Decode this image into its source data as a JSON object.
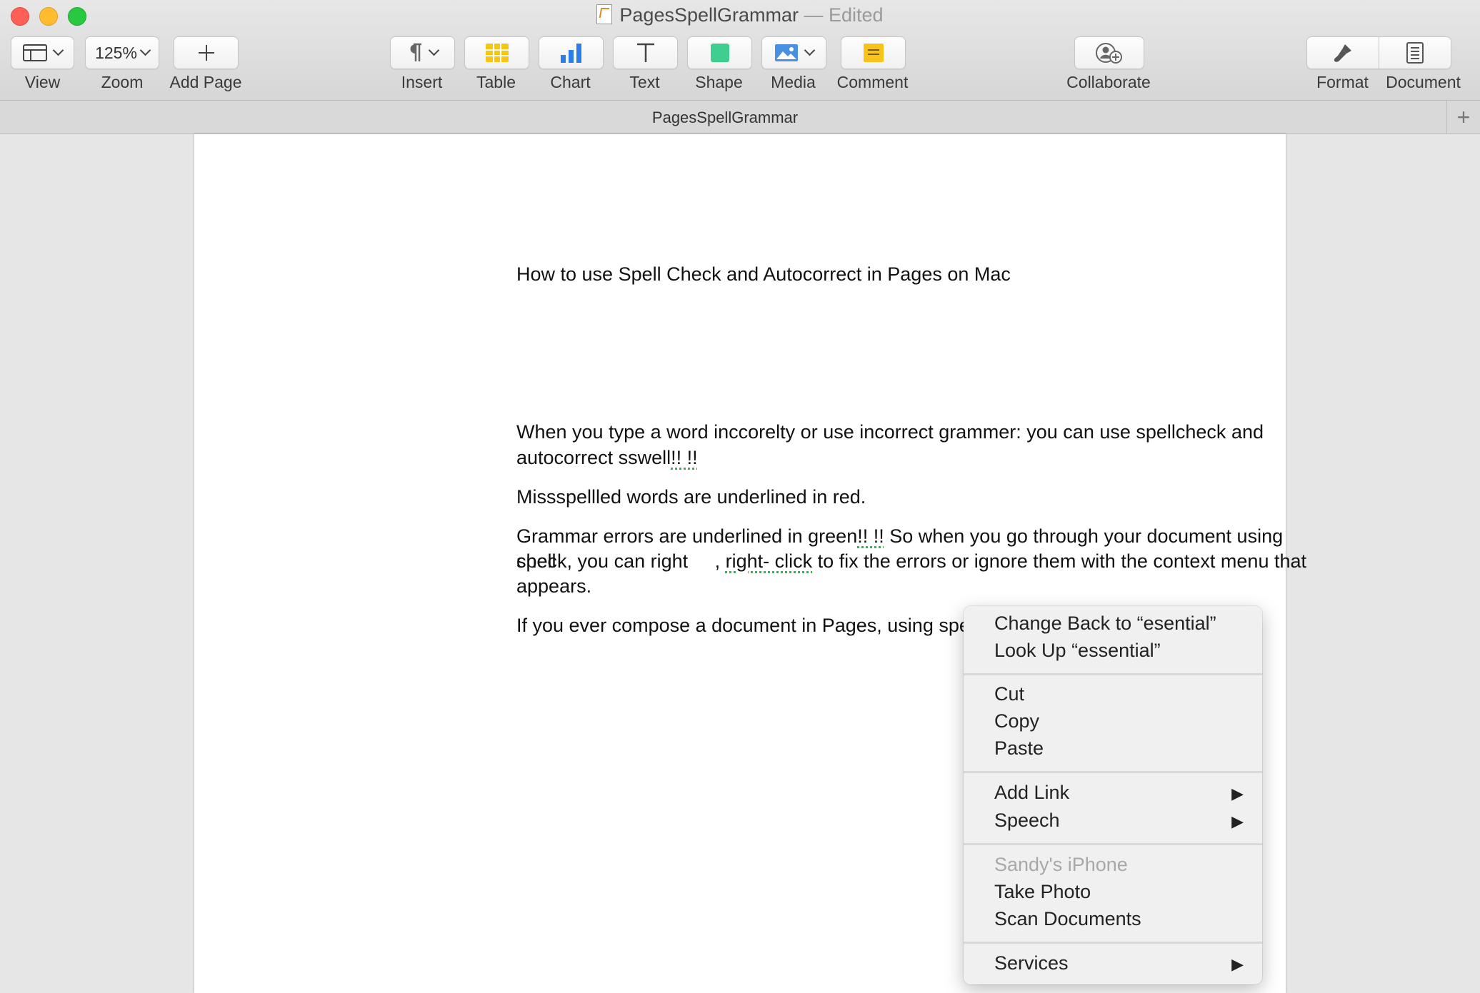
{
  "window": {
    "title": "PagesSpellGrammar",
    "title_status": "— Edited",
    "tab_title": "PagesSpellGrammar"
  },
  "toolbar": {
    "view_label": "View",
    "zoom_value": "125%",
    "zoom_label": "Zoom",
    "add_page_label": "Add Page",
    "insert_label": "Insert",
    "table_label": "Table",
    "chart_label": "Chart",
    "text_label": "Text",
    "shape_label": "Shape",
    "media_label": "Media",
    "comment_label": "Comment",
    "collaborate_label": "Collaborate",
    "format_label": "Format",
    "document_label": "Document"
  },
  "document": {
    "heading": "How to use Spell Check and Autocorrect in Pages on Mac",
    "para1_line1": "When you type a word inccorelty or use incorrect grammer: you can use spellcheck and",
    "para1_line2_a": "autocorrect sswell",
    "para1_line2_b": "!! !!",
    "para2": "Missspellled words are underlined in red.",
    "para3_line1_a": "Grammar errors are underlined in green",
    "para3_line1_b": "!! !!",
    "para3_line1_c": " So when you go through your document using spell",
    "para3_line2_a": "check, you can right     , ",
    "para3_line2_b": "right- click",
    "para3_line2_c": " to fix the errors or ignore them with the context menu that",
    "para3_line3": "appears.",
    "para4_a": "If you ever compose a document in Pages, using spell check is ",
    "para4_selected": "essential",
    "para4_b": "."
  },
  "context_menu": {
    "change_back": "Change Back to “esential”",
    "look_up": "Look Up “essential”",
    "cut": "Cut",
    "copy": "Copy",
    "paste": "Paste",
    "add_link": "Add Link",
    "speech": "Speech",
    "device": "Sandy's iPhone",
    "take_photo": "Take Photo",
    "scan_documents": "Scan Documents",
    "services": "Services"
  },
  "colors": {
    "table_icon": "#f5c518",
    "chart_icon": "#2b7de9",
    "shape_icon": "#3ecf8e",
    "media_icon": "#4a90e2",
    "comment_icon": "#f7c31a",
    "selection": "#b5d9dd",
    "grammar_underline": "#3cad5c"
  }
}
